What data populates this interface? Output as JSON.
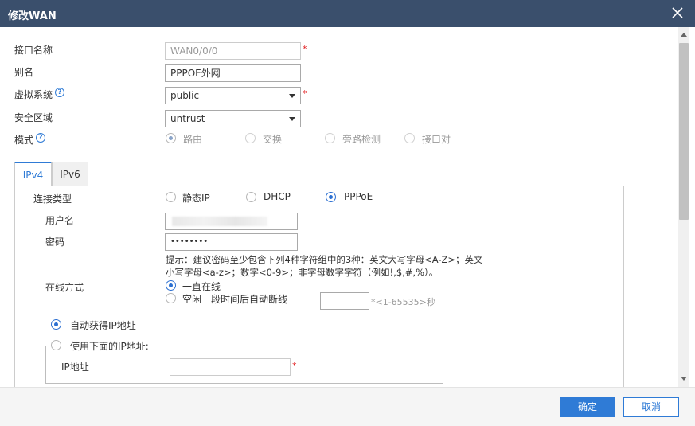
{
  "dialog": {
    "title": "修改WAN"
  },
  "fields": {
    "interface_name": {
      "label": "接口名称",
      "value": "WAN0/0/0"
    },
    "alias": {
      "label": "别名",
      "value": "PPPOE外网"
    },
    "virtual_system": {
      "label": "虚拟系统",
      "value": "public"
    },
    "security_zone": {
      "label": "安全区域",
      "value": "untrust"
    },
    "mode": {
      "label": "模式",
      "options": [
        "路由",
        "交换",
        "旁路检测",
        "接口对"
      ]
    }
  },
  "required_mark": "*",
  "help_mark": "?",
  "tabs": [
    {
      "label": "IPv4"
    },
    {
      "label": "IPv6"
    }
  ],
  "ipv4": {
    "connection_type": {
      "label": "连接类型",
      "options": [
        "静态IP",
        "DHCP",
        "PPPoE"
      ]
    },
    "username": {
      "label": "用户名"
    },
    "password": {
      "label": "密码",
      "value": "••••••••"
    },
    "password_hint": "提示：建议密码至少包含下列4种字符组中的3种：英文大写字母<A-Z>；英文小写字母<a-z>；数字<0-9>；非字母数字字符（例如!,$,#,%）。",
    "online_mode": {
      "label": "在线方式",
      "options": [
        "一直在线",
        "空闲一段时间后自动断线"
      ],
      "range_unit": "*<1-65535>秒"
    },
    "ip_auto": "自动获得IP地址",
    "ip_manual": "使用下面的IP地址:",
    "ip_address": {
      "label": "IP地址"
    }
  },
  "footer": {
    "ok": "确定",
    "cancel": "取消"
  },
  "colors": {
    "titlebar": "#3a4f6c",
    "accent": "#2f7bd6",
    "required": "#e0191b"
  }
}
